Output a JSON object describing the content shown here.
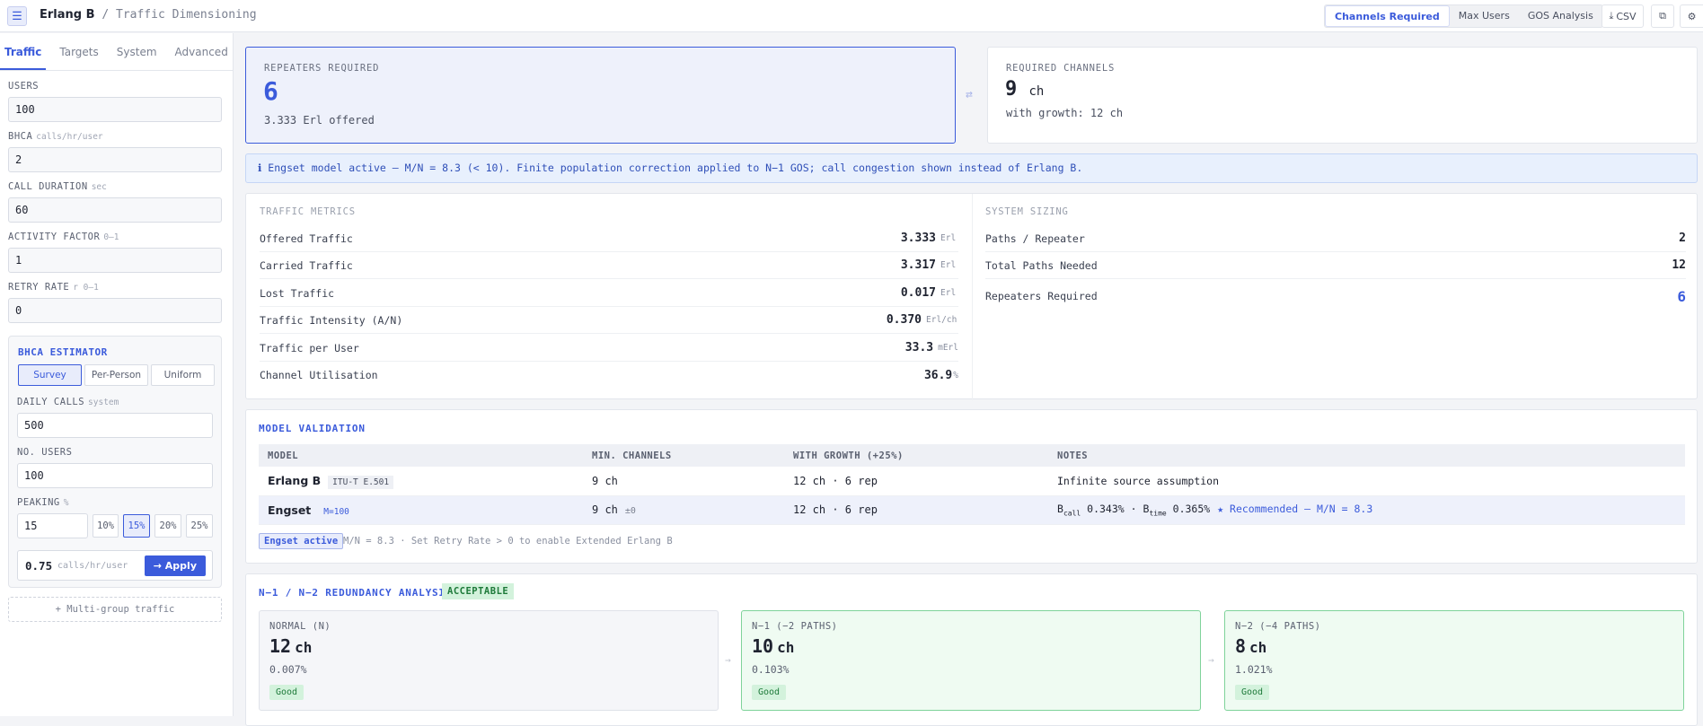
{
  "header": {
    "app_name": "Erlang B",
    "separator": " / ",
    "subtitle": "Traffic Dimensioning",
    "modes": [
      "Channels Required",
      "Max Users",
      "GOS Analysis"
    ],
    "csv_label": "CSV"
  },
  "sidebar": {
    "tabs": [
      "Traffic",
      "Targets",
      "System",
      "Advanced"
    ],
    "fields": {
      "users": {
        "label": "USERS",
        "unit": "",
        "value": "100"
      },
      "bhca": {
        "label": "BHCA",
        "unit": "calls/hr/user",
        "value": "2"
      },
      "duration": {
        "label": "CALL DURATION",
        "unit": "sec",
        "value": "60"
      },
      "activity": {
        "label": "ACTIVITY FACTOR",
        "unit": "0–1",
        "value": "1"
      },
      "retry": {
        "label": "RETRY RATE",
        "unit": "r 0–1",
        "value": "0"
      }
    },
    "estimator": {
      "title": "BHCA ESTIMATOR",
      "modes": [
        "Survey",
        "Per-Person",
        "Uniform"
      ],
      "daily_calls": {
        "label": "DAILY CALLS",
        "unit": "system",
        "value": "500"
      },
      "num_users": {
        "label": "NO. USERS",
        "unit": "",
        "value": "100"
      },
      "peaking": {
        "label": "PEAKING",
        "unit": "%",
        "value": "15"
      },
      "peak_options": [
        "10%",
        "15%",
        "20%",
        "25%"
      ],
      "result_value": "0.75",
      "result_unit": "calls/hr/user",
      "apply_label": "→ Apply"
    },
    "multi_group": "+ Multi-group traffic"
  },
  "summary": {
    "repeaters_label": "REPEATERS REQUIRED",
    "repeaters_value": "6",
    "offered": "3.333 Erl offered",
    "channels_label": "REQUIRED CHANNELS",
    "channels_value": "9",
    "channels_unit": "ch",
    "growth": "with growth: 12 ch"
  },
  "info_banner": "ℹ  Engset model active — M/N = 8.3 (< 10). Finite population correction applied to N−1 GOS; call congestion shown instead of Erlang B.",
  "traffic_metrics": {
    "title": "TRAFFIC METRICS",
    "rows": [
      {
        "label": "Offered Traffic",
        "value": "3.333",
        "unit": "Erl"
      },
      {
        "label": "Carried Traffic",
        "value": "3.317",
        "unit": "Erl"
      },
      {
        "label": "Lost Traffic",
        "value": "0.017",
        "unit": "Erl"
      },
      {
        "label": "Traffic Intensity (A/N)",
        "value": "0.370",
        "unit": "Erl/ch"
      },
      {
        "label": "Traffic per User",
        "value": "33.3",
        "unit": "mErl"
      },
      {
        "label": "Channel Utilisation",
        "value": "36.9",
        "unit": "%"
      }
    ]
  },
  "system_sizing": {
    "title": "SYSTEM SIZING",
    "rows": [
      {
        "label": "Paths / Repeater",
        "value": "2"
      },
      {
        "label": "Total Paths Needed",
        "value": "12"
      },
      {
        "label": "Repeaters Required",
        "value": "6"
      }
    ]
  },
  "validation": {
    "title": "MODEL VALIDATION",
    "headers": [
      "MODEL",
      "MIN. CHANNELS",
      "WITH GROWTH (+25%)",
      "NOTES"
    ],
    "rows": [
      {
        "model": "Erlang B",
        "tag": "ITU-T E.501",
        "min": "9 ch",
        "delta": "",
        "growth": "12 ch · 6 rep",
        "notes": "Infinite source assumption"
      },
      {
        "model": "Engset",
        "tag": "M=100",
        "min": "9 ch",
        "delta": "±0",
        "growth": "12 ch · 6 rep",
        "b_call_sym": "B",
        "b_call_sub": "call",
        "b_call_val": "0.343%",
        "sep": "·",
        "b_time_sym": "B",
        "b_time_sub": "time",
        "b_time_val": "0.365%",
        "recommend": "★ Recommended — M/N = 8.3"
      }
    ],
    "footer_badge": "Engset active",
    "footer_text": "M/N = 8.3 · Set Retry Rate > 0 to enable Extended Erlang B"
  },
  "redundancy": {
    "title": "N−1 / N−2 REDUNDANCY ANALYSIS",
    "status": "ACCEPTABLE",
    "cards": [
      {
        "label": "NORMAL (N)",
        "value": "12",
        "unit": "ch",
        "pct": "0.007%",
        "badge": "Good"
      },
      {
        "label": "N−1 (−2 PATHS)",
        "value": "10",
        "unit": "ch",
        "pct": "0.103%",
        "badge": "Good"
      },
      {
        "label": "N−2 (−4 PATHS)",
        "value": "8",
        "unit": "ch",
        "pct": "1.021%",
        "badge": "Good"
      }
    ],
    "arrow": "→"
  },
  "icons": {
    "menu": "menu-icon",
    "swap": "swap-icon",
    "download": "download-icon",
    "copy": "copy-icon",
    "settings": "settings-icon"
  }
}
